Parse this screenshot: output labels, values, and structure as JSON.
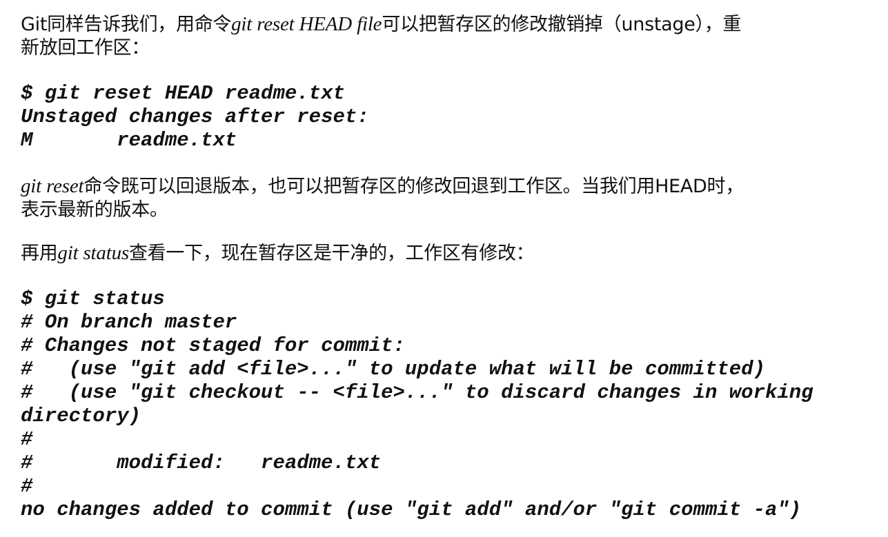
{
  "para1": {
    "t1": "Git同样告诉我们，用命令",
    "cmd": "git reset HEAD file",
    "t2": "可以把暂存区的修改撤销掉（unstage），重",
    "line2": "新放回工作区："
  },
  "code1": [
    "$ git reset HEAD readme.txt",
    "Unstaged changes after reset:",
    "M       readme.txt"
  ],
  "para2": {
    "cmd": "git reset",
    "t1": "命令既可以回退版本，也可以把暂存区的修改回退到工作区。当我们用HEAD时，",
    "line2": "表示最新的版本。"
  },
  "para3": {
    "t1": "再用",
    "cmd": "git status",
    "t2": "查看一下，现在暂存区是干净的，工作区有修改："
  },
  "code2": [
    "$ git status",
    "# On branch master",
    "# Changes not staged for commit:",
    "#   (use \"git add <file>...\" to update what will be committed)",
    "#   (use \"git checkout -- <file>...\" to discard changes in working",
    "directory)",
    "#",
    "#       modified:   readme.txt",
    "#",
    "no changes added to commit (use \"git add\" and/or \"git commit -a\")"
  ]
}
